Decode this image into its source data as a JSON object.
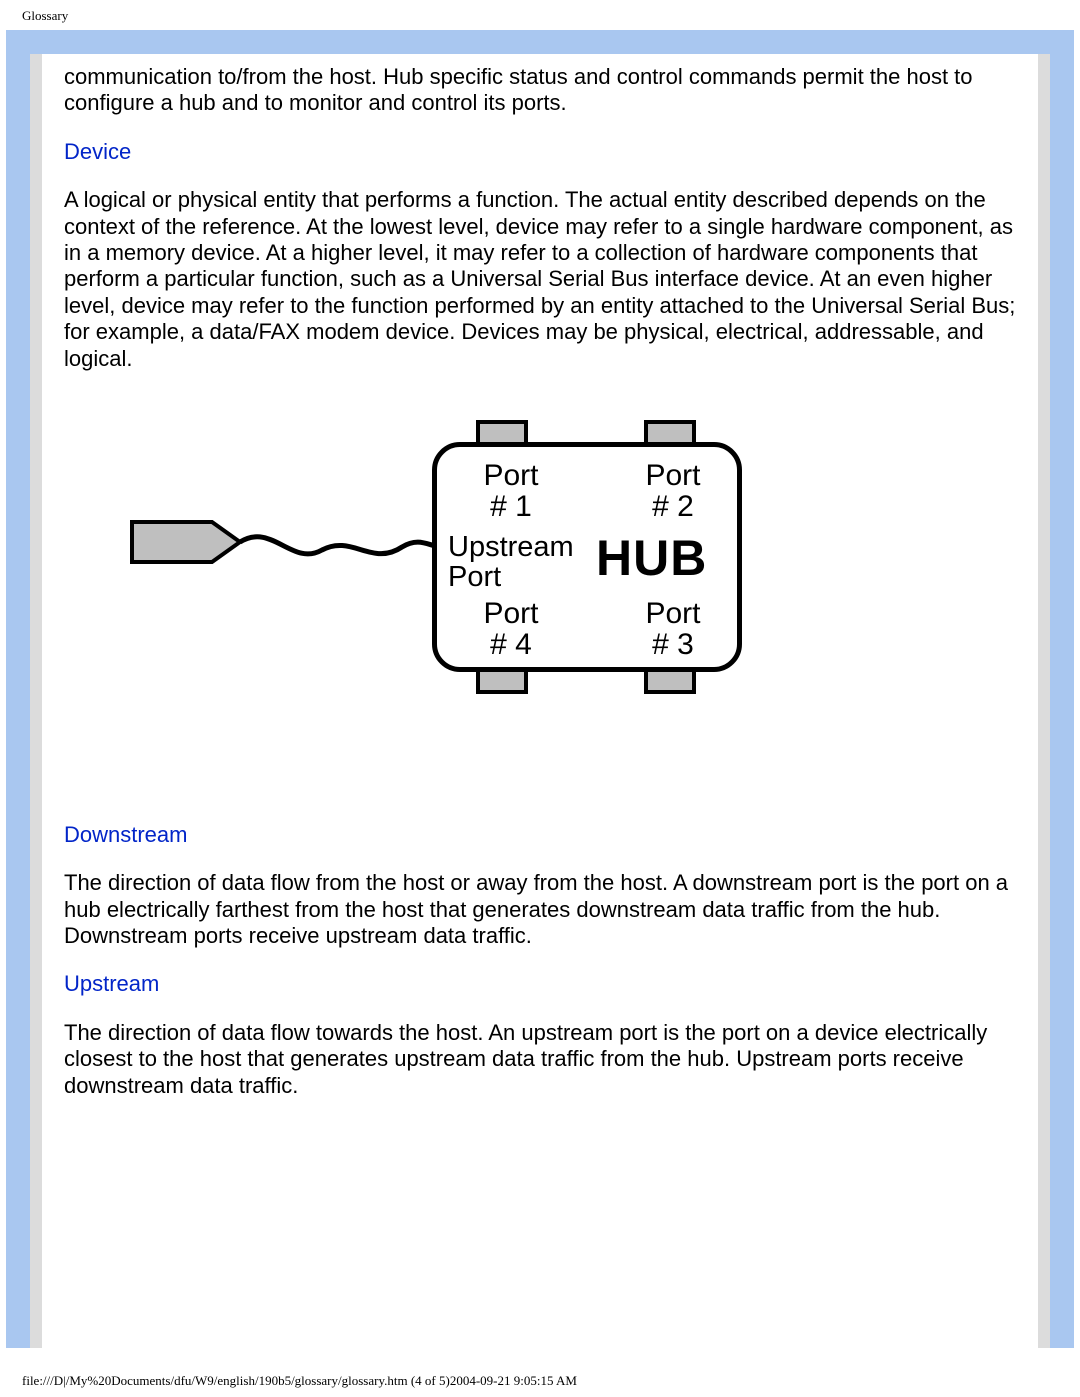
{
  "meta": {
    "header_title": "Glossary",
    "footer_line": "file:///D|/My%20Documents/dfu/W9/english/190b5/glossary/glossary.htm (4 of 5)2004-09-21 9:05:15 AM"
  },
  "body": {
    "intro_continuation": "communication to/from the host. Hub specific status and control commands permit the host to configure a hub and to monitor and control its ports.",
    "device_heading": "Device",
    "device_text": "A logical or physical entity that performs a function. The actual entity described depends on the context of the reference. At the lowest level, device may refer to a single hardware component, as in a memory device. At a higher level, it may refer to a collection of hardware components that perform a particular function, such as a Universal Serial Bus interface device. At an even higher level, device may refer to the function performed by an entity attached to the Universal Serial Bus; for example, a data/FAX modem device. Devices may be physical, electrical, addressable, and logical.",
    "downstream_heading": "Downstream",
    "downstream_text": "The direction of data flow from the host or away from the host. A downstream port is the port on a hub electrically farthest from the host that generates downstream data traffic from the hub. Downstream ports receive upstream data traffic.",
    "upstream_heading": "Upstream",
    "upstream_text": "The direction of data flow towards the host. An upstream port is the port on a device electrically closest to the host that generates upstream data traffic from the hub. Upstream ports receive downstream data traffic."
  },
  "figure": {
    "port1": "Port\n# 1",
    "port2": "Port\n# 2",
    "port3": "Port\n# 3",
    "port4": "Port\n# 4",
    "upstream_port": "Upstream\nPort",
    "hub_label": "HUB"
  }
}
